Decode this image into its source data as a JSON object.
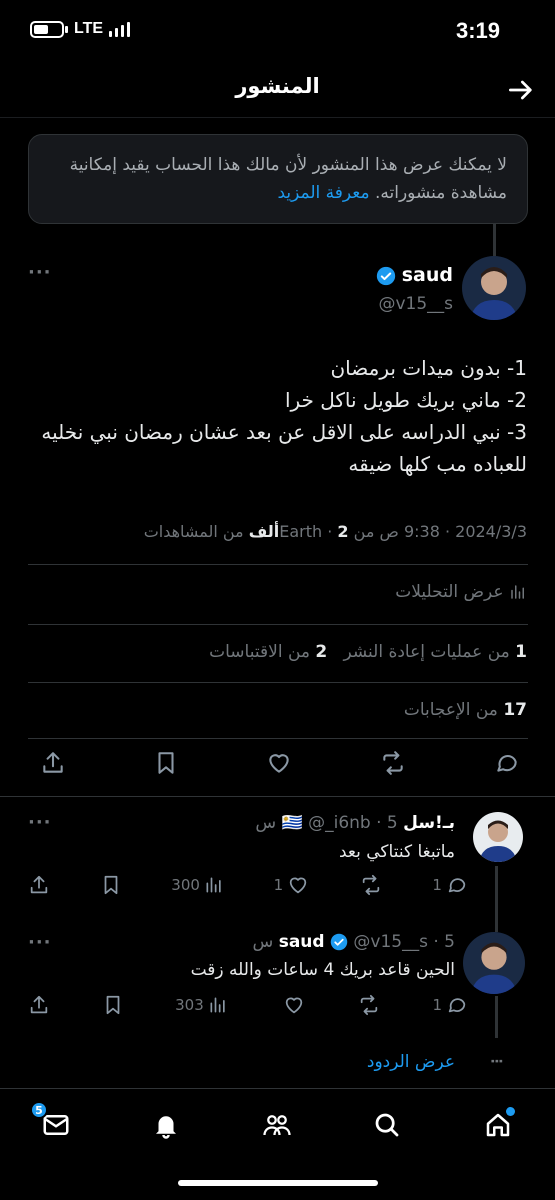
{
  "status": {
    "time": "3:19",
    "network": "LTE"
  },
  "header": {
    "title": "المنشور"
  },
  "notice": {
    "text": "لا يمكنك عرض هذا المنشور لأن مالك هذا الحساب يقيد إمكانية مشاهدة منشوراته.",
    "link": "معرفة المزيد"
  },
  "tweet": {
    "name": "saud",
    "handle": "@v15__s",
    "lines": [
      "1- بدون ميدات برمضان",
      "2- ماني بريك طويل ناكل خرا",
      "3- نبي الدراسه على الاقل عن بعد عشان رمضان نبي نخليه للعباده مب كلها ضيقه"
    ],
    "date": "2024/3/3",
    "time": "9:38 ص",
    "from": "من Earth",
    "views_count": "2ألف",
    "views_label": "من المشاهدات",
    "analytics_label": "عرض التحليلات",
    "reposts_count": "1",
    "reposts_label": "من عمليات إعادة النشر",
    "quotes_count": "2",
    "quotes_label": "من الاقتباسات",
    "likes_count": "17",
    "likes_label": "من الإعجابات"
  },
  "replies": [
    {
      "name": "بـ!سل",
      "flag": "🇺🇾",
      "handle": "@_i6nb",
      "age": "5 س",
      "text": "ماتبغا كنتاكي بعد",
      "views": "300",
      "likes": "1",
      "replies": "1"
    },
    {
      "name": "saud",
      "handle": "@v15__s",
      "age": "5 س",
      "text": "الحين قاعد بريك 4 ساعات والله زقت",
      "views": "303",
      "likes": "",
      "replies": "1"
    }
  ],
  "show_replies": "عرض الردود",
  "tabbar": {
    "messages_badge": "5"
  },
  "colors": {
    "accent": "#1d9bf0",
    "background": "#000000",
    "muted": "#71767b"
  }
}
